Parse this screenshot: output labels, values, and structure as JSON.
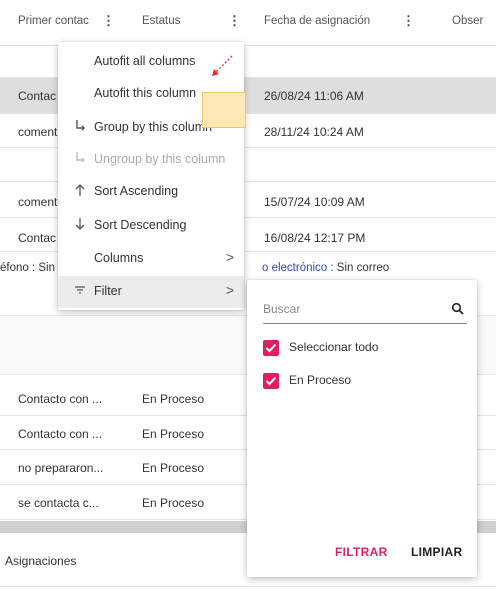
{
  "grid": {
    "headers": {
      "col1": "Primer contac",
      "col2": "Estatus",
      "col3": "Fecha de asignación",
      "col4": "Obser"
    },
    "menu_glyph": "⋮",
    "rows_top": [
      {
        "c1": "Contac",
        "c3": "26/08/24 11:06 AM"
      },
      {
        "c1": "coment",
        "c3": "28/11/24 10:24 AM"
      },
      {
        "c1": "coment",
        "c3": "15/07/24 10:09 AM"
      },
      {
        "c1": "Contac",
        "c3": "16/08/24 12:17 PM"
      }
    ],
    "detail_line": {
      "part1": "éfono : Sin",
      "link": "o electrónico",
      "part2": " : Sin correo"
    },
    "rows_bottom": [
      {
        "c1": "Contacto con ...",
        "c2": "En Proceso"
      },
      {
        "c1": "Contacto con ...",
        "c2": "En Proceso"
      },
      {
        "c1": "no prepararon...",
        "c2": "En Proceso"
      },
      {
        "c1": "se contacta c...",
        "c2": "En Proceso"
      }
    ],
    "footer_label": "Asignaciones"
  },
  "column_menu": {
    "items": [
      {
        "label": "Autofit all columns",
        "icon": ""
      },
      {
        "label": "Autofit this column",
        "icon": ""
      },
      {
        "label": "Group by this column",
        "icon": "group-icon"
      },
      {
        "label": "Ungroup by this column",
        "icon": "ungroup-icon",
        "disabled": true
      },
      {
        "label": "Sort Ascending",
        "icon": "arrow-up-icon"
      },
      {
        "label": "Sort Descending",
        "icon": "arrow-down-icon"
      },
      {
        "label": "Columns",
        "icon": "",
        "submenu": true
      },
      {
        "label": "Filter",
        "icon": "filter-icon",
        "submenu": true,
        "active": true
      }
    ]
  },
  "filter_panel": {
    "search_placeholder": "Buscar",
    "options": [
      {
        "label": "Seleccionar todo",
        "checked": true
      },
      {
        "label": "En Proceso",
        "checked": true
      }
    ],
    "filter_button": "FILTRAR",
    "clear_button": "LIMPIAR"
  },
  "colors": {
    "accent": "#e0205e",
    "link": "#2b45c8",
    "selected_row": "#dedede"
  }
}
